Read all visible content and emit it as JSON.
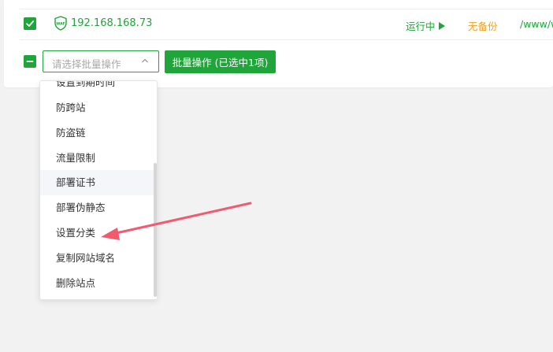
{
  "site_row": {
    "ip": "192.168.168.73",
    "status": "运行中",
    "backup": "无备份",
    "path": "/www/w",
    "selected": true
  },
  "batch": {
    "select_placeholder": "请选择批量操作",
    "button_label": "批量操作 (已选中1项)"
  },
  "dropdown": {
    "items": [
      "设置到期时间",
      "防跨站",
      "防盗链",
      "流量限制",
      "部署证书",
      "部署伪静态",
      "设置分类",
      "复制网站域名",
      "删除站点"
    ],
    "hovered_item": "部署证书"
  },
  "icons": {
    "row_checkbox": "check-icon",
    "select_all_checkbox": "minus-icon",
    "site_type": "waf-shield-icon",
    "status": "play-icon",
    "select": "chevron-up-icon",
    "annotation": "red-arrow-icon"
  },
  "colors": {
    "accent": "#20a53a",
    "backup_warning": "#f0a020",
    "annotation_arrow": "#f25a6e"
  }
}
